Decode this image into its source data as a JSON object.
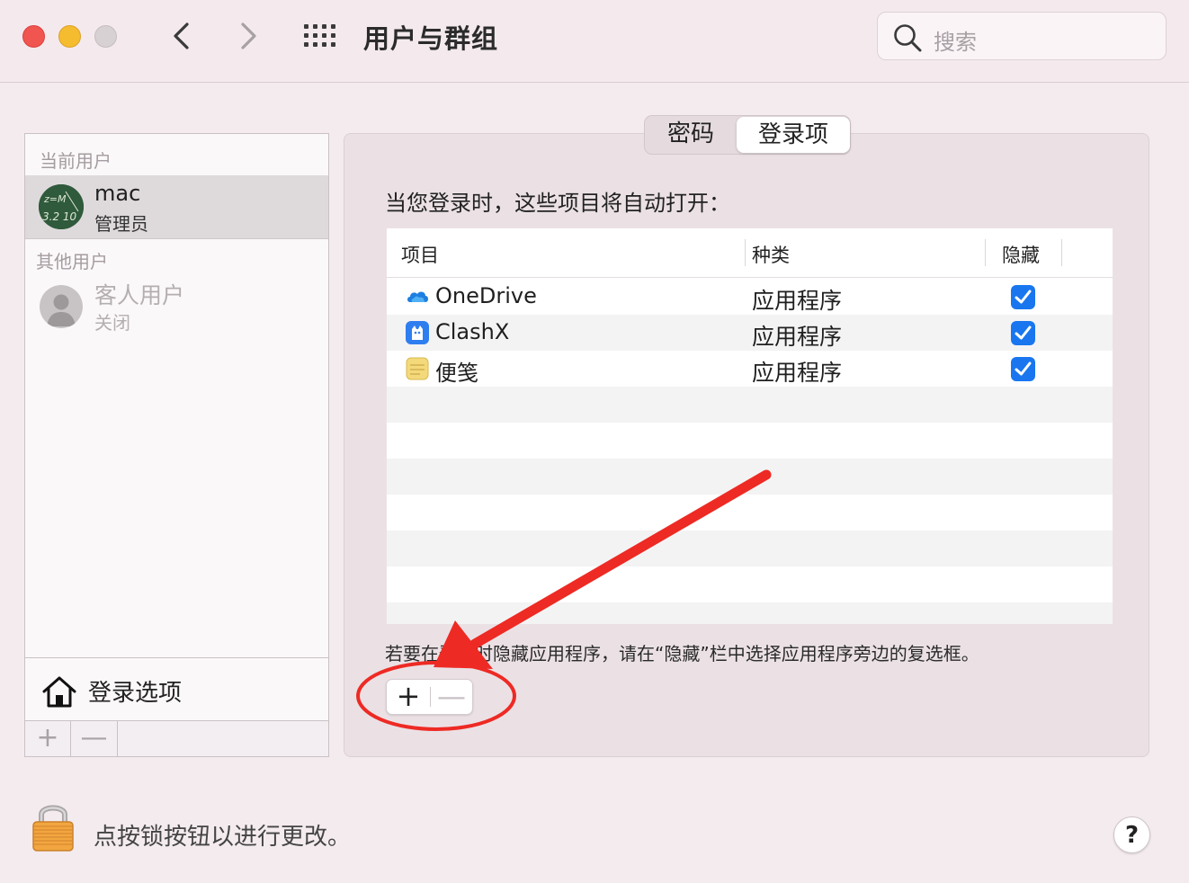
{
  "window": {
    "title": "用户与群组",
    "search_placeholder": "搜索"
  },
  "users": {
    "current_section": "当前用户",
    "current_user": {
      "name": "mac",
      "role": "管理员"
    },
    "other_section": "其他用户",
    "guest_user": {
      "name": "客人用户",
      "status": "关闭"
    },
    "login_options_label": "登录选项",
    "add_symbol": "+",
    "remove_symbol": "—"
  },
  "tabs": [
    {
      "label": "密码",
      "selected": false
    },
    {
      "label": "登录项",
      "selected": true
    }
  ],
  "login_items": {
    "intro": "当您登录时，这些项目将自动打开：",
    "columns": [
      "项目",
      "种类",
      "隐藏"
    ],
    "rows": [
      {
        "name": "OneDrive",
        "kind": "应用程序",
        "hidden": true,
        "icon": "onedrive-icon"
      },
      {
        "name": "ClashX",
        "kind": "应用程序",
        "hidden": true,
        "icon": "clashx-icon"
      },
      {
        "name": "便笺",
        "kind": "应用程序",
        "hidden": true,
        "icon": "stickies-icon"
      }
    ],
    "hint": "若要在登录时隐藏应用程序，请在“隐藏”栏中选择应用程序旁边的复选框。",
    "add_symbol": "+",
    "remove_symbol": "—"
  },
  "footer": {
    "lock_text": "点按锁按钮以进行更改。",
    "help_symbol": "?"
  },
  "colors": {
    "window_bg": "#f4ebef",
    "checkbox_blue": "#1976ef",
    "annotation_red": "#ee2a24",
    "close": "#f0554f",
    "minimize": "#f6bc2f"
  }
}
